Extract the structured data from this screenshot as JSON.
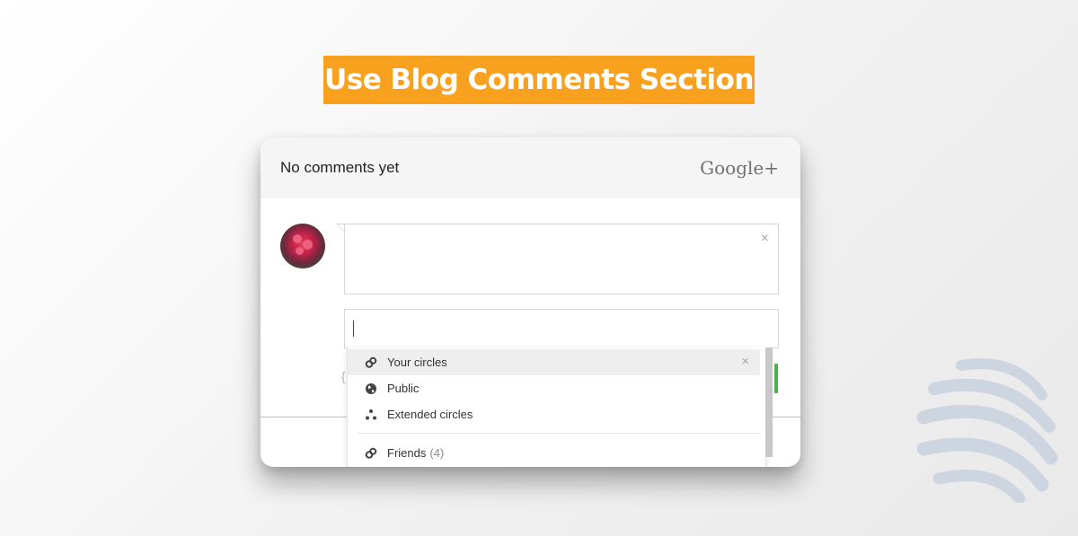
{
  "banner": {
    "title": "Use Blog Comments Section"
  },
  "card": {
    "status_text": "No comments yet",
    "brand": "Google+",
    "comment_close": "×",
    "suggest_close": "×"
  },
  "dropdown": {
    "items": [
      {
        "label": "Your circles",
        "count": "",
        "icon": "circles-icon"
      },
      {
        "label": "Public",
        "count": "",
        "icon": "globe-icon"
      },
      {
        "label": "Extended circles",
        "count": "",
        "icon": "extended-circles-icon"
      },
      {
        "label": "Friends",
        "count": "(4)",
        "icon": "circles-icon"
      }
    ]
  },
  "colors": {
    "banner": "#f8a11f",
    "accent_green": "#4caf50",
    "logo": "#cdd5e0"
  }
}
